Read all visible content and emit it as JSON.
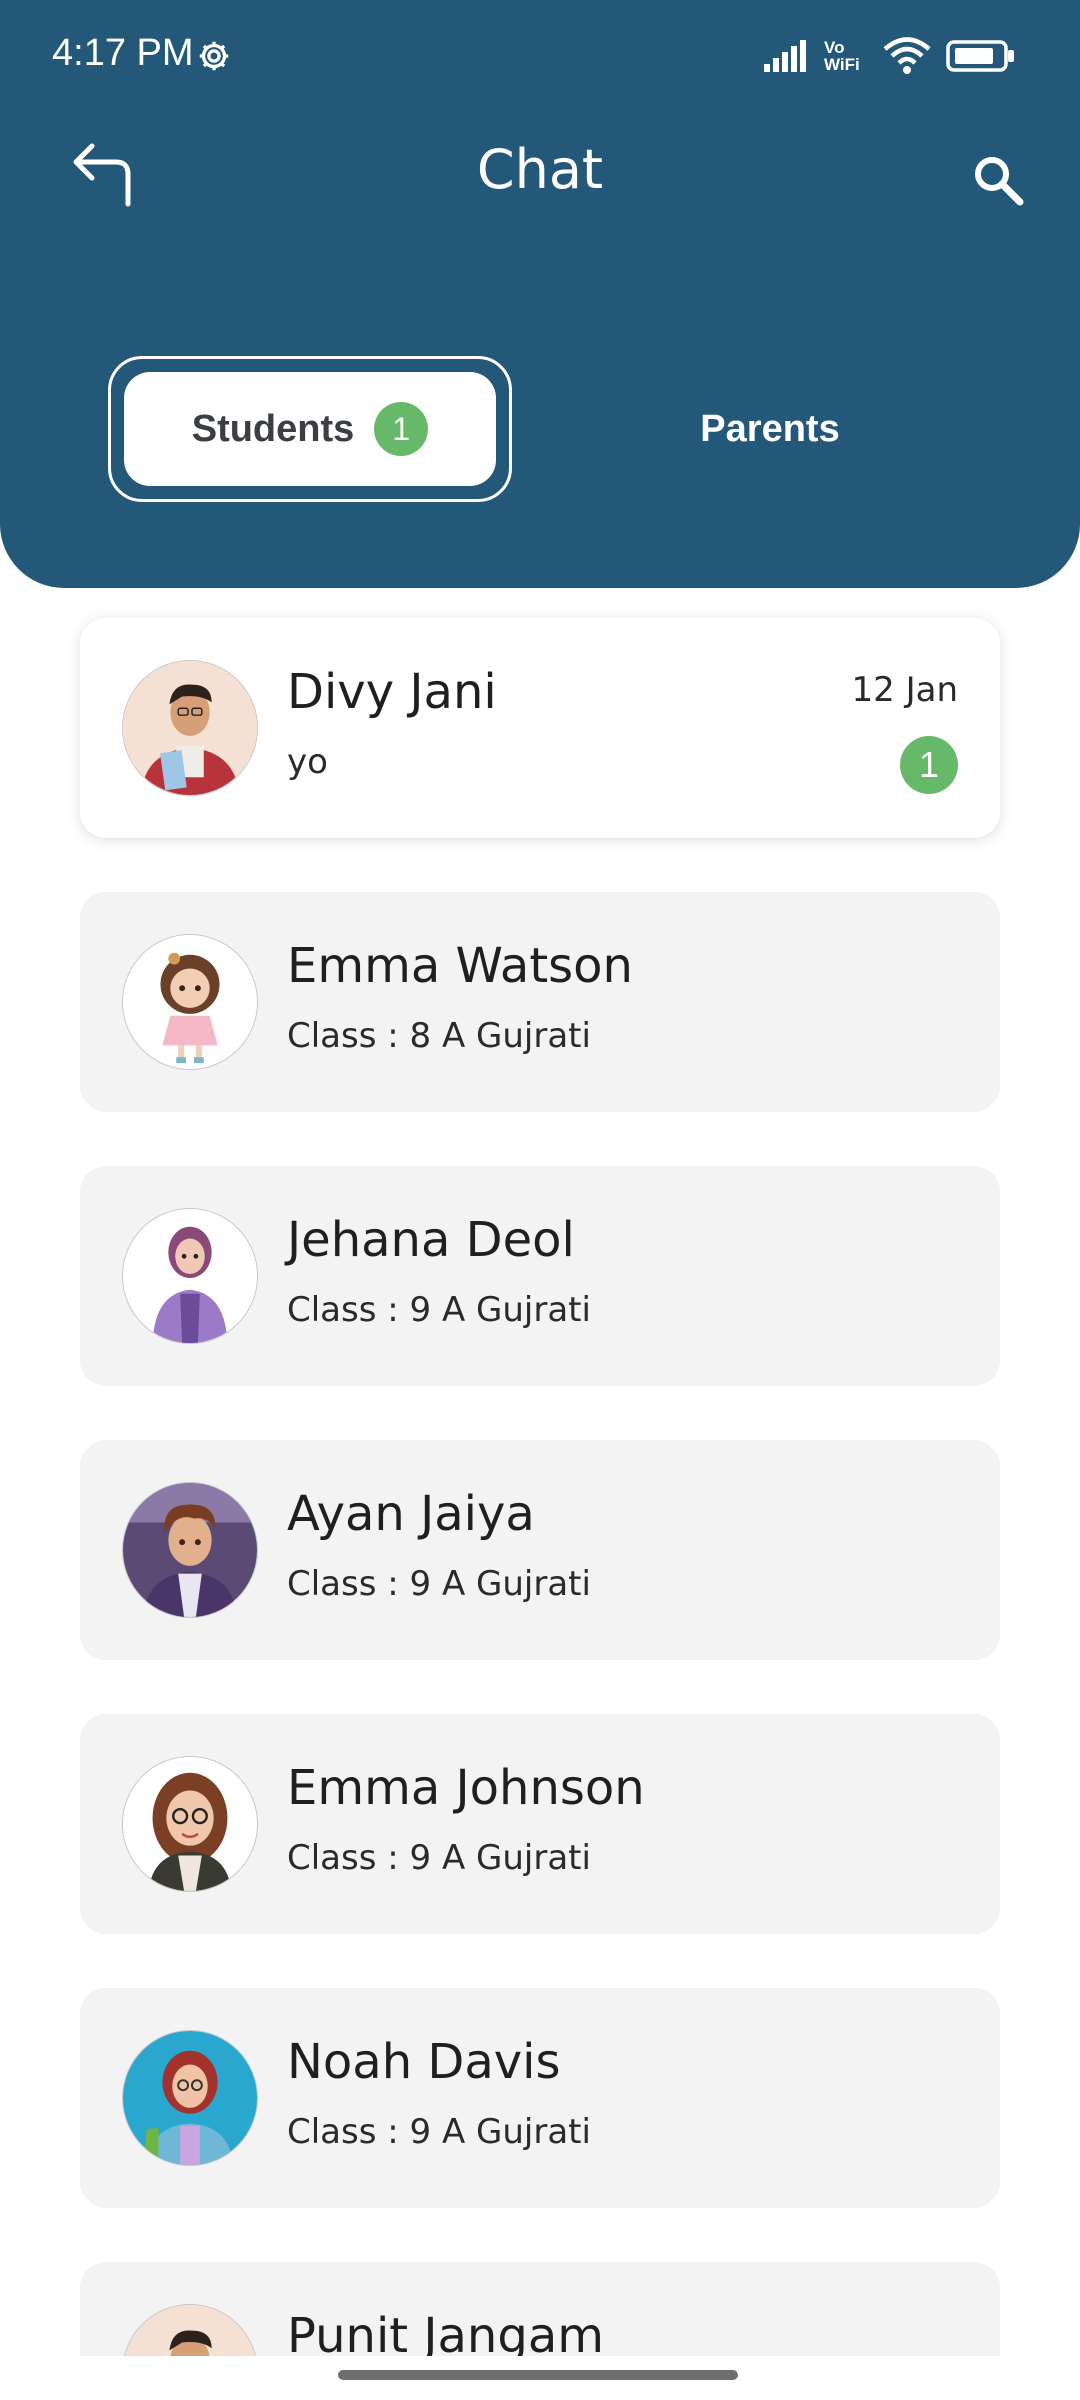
{
  "status_bar": {
    "time": "4:17 PM",
    "network_label": "Vo\nWiFi"
  },
  "header": {
    "title": "Chat",
    "color": "#245879"
  },
  "tabs": [
    {
      "label": "Students",
      "badge": "1",
      "selected": true
    },
    {
      "label": "Parents",
      "selected": false
    }
  ],
  "chats": [
    {
      "name": "Divy Jani",
      "subtitle": "yo",
      "date": "12 Jan",
      "unread": "1",
      "avatar": "boy-holding-books-avatar"
    },
    {
      "name": "Emma Watson",
      "subtitle": "Class : 8 A Gujrati",
      "avatar": "girl-pink-dress-avatar"
    },
    {
      "name": "Jehana Deol",
      "subtitle": "Class : 9 A Gujrati",
      "avatar": "girl-purple-jacket-avatar"
    },
    {
      "name": "Ayan Jaiya",
      "subtitle": "Class : 9 A Gujrati",
      "avatar": "boy-school-hallway-avatar"
    },
    {
      "name": "Emma Johnson",
      "subtitle": "Class : 9 A Gujrati",
      "avatar": "girl-glasses-avatar"
    },
    {
      "name": "Noah Davis",
      "subtitle": "Class : 9 A Gujrati",
      "avatar": "girl-backpack-avatar"
    },
    {
      "name": "Punit Jangam",
      "subtitle": "",
      "avatar": "boy-avatar"
    }
  ],
  "colors": {
    "accent": "#245879",
    "badge_green": "#67b96a",
    "card_bg": "#f3f3f3"
  }
}
